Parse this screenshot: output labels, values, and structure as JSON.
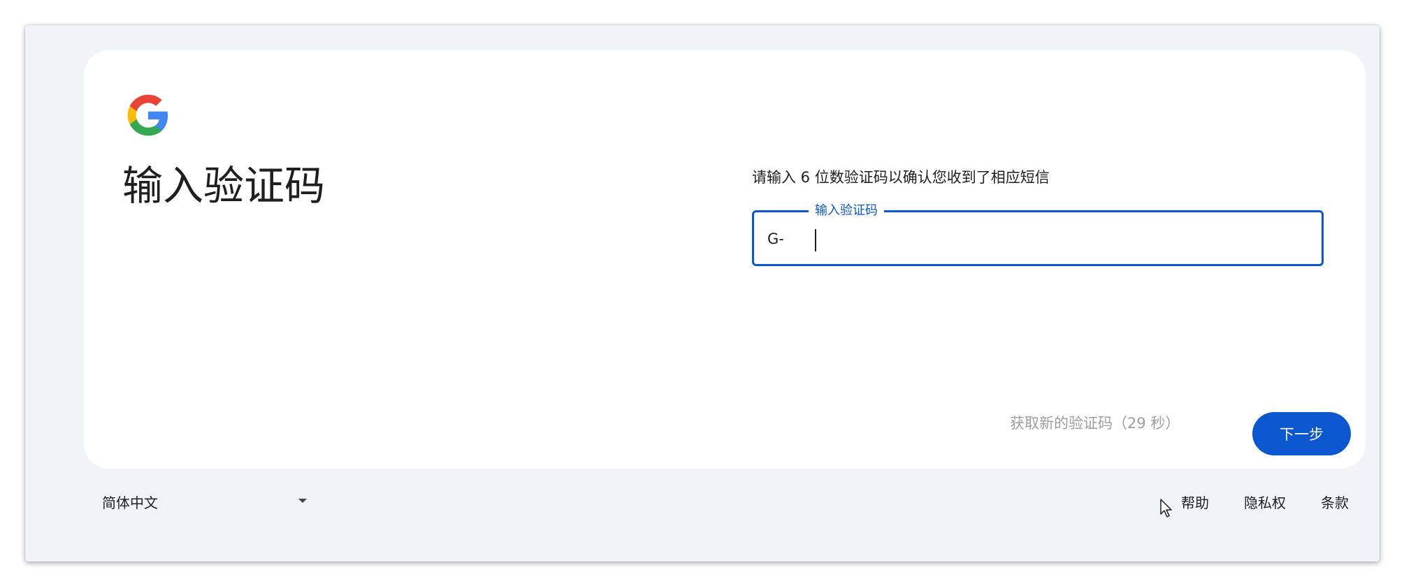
{
  "card": {
    "title": "输入验证码",
    "instruction": "请输入 6 位数验证码以确认您收到了相应短信",
    "code_field": {
      "label": "输入验证码",
      "prefix": "G-",
      "value": ""
    },
    "resend_label": "获取新的验证码（29 秒）",
    "next_label": "下一步"
  },
  "footer": {
    "language": "简体中文",
    "links": [
      "帮助",
      "隐私权",
      "条款"
    ]
  },
  "icons": {
    "logo": "google-g-logo",
    "language_dropdown": "chevron-down-icon",
    "pointer": "mouse-cursor-icon"
  },
  "colors": {
    "accent": "#0b57d0",
    "background": "#f0f4f9",
    "card": "#ffffff",
    "disabled_text": "#9e9e9e",
    "logo_blue": "#4285f4",
    "logo_red": "#ea4335",
    "logo_yellow": "#fbbc05",
    "logo_green": "#34a853"
  }
}
